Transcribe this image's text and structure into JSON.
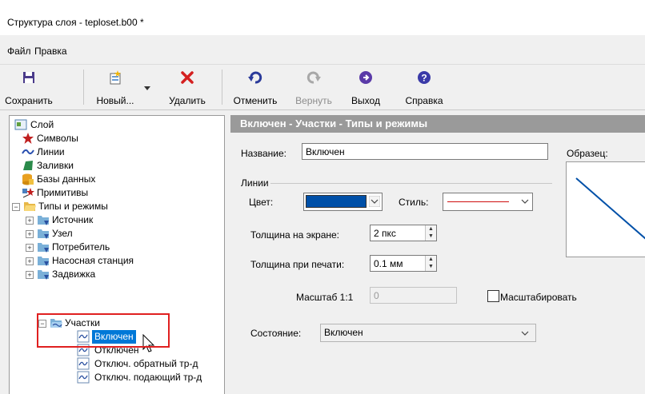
{
  "window": {
    "title": "Структура слоя - teploset.b00 *"
  },
  "menu": {
    "file": "Файл",
    "edit": "Правка"
  },
  "toolbar": {
    "save": "Сохранить",
    "new": "Новый...",
    "delete": "Удалить",
    "undo": "Отменить",
    "redo": "Вернуть",
    "exit": "Выход",
    "help": "Справка"
  },
  "tree": {
    "root": "Слой",
    "symbols": "Символы",
    "lines": "Линии",
    "fills": "Заливки",
    "databases": "Базы данных",
    "primitives": "Примитивы",
    "types": "Типы и режимы",
    "source": "Источник",
    "node": "Узел",
    "consumer": "Потребитель",
    "pump": "Насосная станция",
    "valve": "Задвижка",
    "sections": "Участки",
    "on": "Включен",
    "off": "Отключен",
    "off_return": "Отключ. обратный тр-д",
    "off_supply": "Отключ. подающий тр-д"
  },
  "panel": {
    "header": "Включен - Участки - Типы и режимы",
    "name_label": "Название:",
    "name_value": "Включен",
    "sample_label": "Образец:",
    "lines_group": "Линии",
    "color_label": "Цвет:",
    "style_label": "Стиль:",
    "screen_width_label": "Толщина на экране:",
    "screen_width_value": "2 пкс",
    "print_width_label": "Толщина при печати:",
    "print_width_value": "0.1 мм",
    "scale_label": "Масштаб 1:1",
    "scale_value": "0",
    "scale_checkbox": "Масштабировать",
    "state_label": "Состояние:",
    "state_value": "Включен"
  },
  "colors": {
    "line_color": "#0050a8",
    "style_line": "#d01010",
    "selection": "#0078d7",
    "highlight_box": "#e02020"
  }
}
